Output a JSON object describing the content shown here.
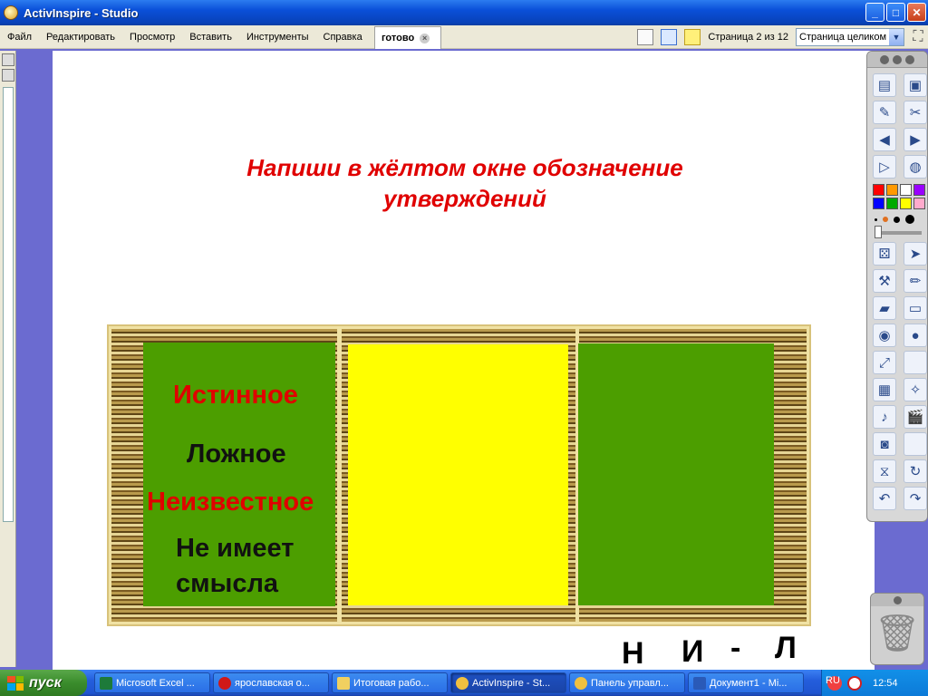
{
  "window": {
    "title": "ActivInspire - Studio",
    "controls": {
      "minimize": "_",
      "maximize": "□",
      "close": "✕"
    }
  },
  "menu": {
    "items": [
      "Файл",
      "Редактировать",
      "Просмотр",
      "Вставить",
      "Инструменты",
      "Справка"
    ],
    "doc_tab": "готово",
    "page_indicator": "Страница 2 из 12",
    "zoom_select": "Страница целиком"
  },
  "slide": {
    "heading_line1": "Напиши в жёлтом окне обозначение",
    "heading_line2": "утверждений",
    "words": [
      "Истинное",
      "Ложное",
      "Неизвестное",
      "Не имеет",
      "смысла"
    ],
    "letters": [
      "Н",
      "И",
      "-",
      "Л"
    ],
    "colors": {
      "green": "#4c9e00",
      "yellow": "#ffff00",
      "red": "#e00000",
      "frame": "#c4a85c"
    }
  },
  "toolbar": {
    "tools": [
      "browser-icon",
      "profile-icon",
      "flipchart-icon",
      "desktop-annotate-icon",
      "prev-page-icon",
      "next-page-icon",
      "play-icon",
      "globe-icon",
      "dice-icon",
      "select-icon",
      "tools-icon",
      "pen-icon",
      "highlighter-icon",
      "eraser-icon",
      "fill-icon",
      "shape-icon",
      "connector-icon",
      "clear-icon",
      "magic-ink-icon",
      "camera-icon",
      "recorder-icon",
      "screen-clip-icon",
      "undo-icon",
      "redo-icon"
    ],
    "palette": [
      "#ff0000",
      "#ff9900",
      "#ffffff",
      "#9900ff",
      "#0000ff",
      "#00aa00",
      "#ffff00",
      "#ffaacc"
    ]
  },
  "taskbar": {
    "start_label": "пуск",
    "tasks": [
      "Microsoft Excel ...",
      "ярославская о...",
      "Итоговая рабо...",
      "ActivInspire - St...",
      "Панель управл...",
      "Документ1 - Mi..."
    ],
    "language": "RU",
    "clock": "12:54"
  }
}
